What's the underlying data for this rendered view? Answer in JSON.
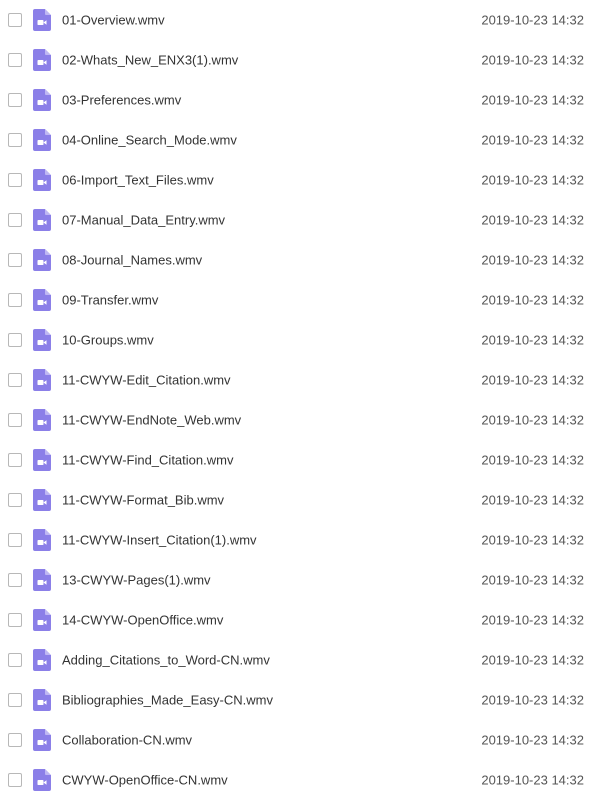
{
  "icon_color": "#8b7fe8",
  "icon_type": "video-file-icon",
  "files": [
    {
      "name": "01-Overview.wmv",
      "date": "2019-10-23 14:32"
    },
    {
      "name": "02-Whats_New_ENX3(1).wmv",
      "date": "2019-10-23 14:32"
    },
    {
      "name": "03-Preferences.wmv",
      "date": "2019-10-23 14:32"
    },
    {
      "name": "04-Online_Search_Mode.wmv",
      "date": "2019-10-23 14:32"
    },
    {
      "name": "06-Import_Text_Files.wmv",
      "date": "2019-10-23 14:32"
    },
    {
      "name": "07-Manual_Data_Entry.wmv",
      "date": "2019-10-23 14:32"
    },
    {
      "name": "08-Journal_Names.wmv",
      "date": "2019-10-23 14:32"
    },
    {
      "name": "09-Transfer.wmv",
      "date": "2019-10-23 14:32"
    },
    {
      "name": "10-Groups.wmv",
      "date": "2019-10-23 14:32"
    },
    {
      "name": "11-CWYW-Edit_Citation.wmv",
      "date": "2019-10-23 14:32"
    },
    {
      "name": "11-CWYW-EndNote_Web.wmv",
      "date": "2019-10-23 14:32"
    },
    {
      "name": "11-CWYW-Find_Citation.wmv",
      "date": "2019-10-23 14:32"
    },
    {
      "name": "11-CWYW-Format_Bib.wmv",
      "date": "2019-10-23 14:32"
    },
    {
      "name": "11-CWYW-Insert_Citation(1).wmv",
      "date": "2019-10-23 14:32"
    },
    {
      "name": "13-CWYW-Pages(1).wmv",
      "date": "2019-10-23 14:32"
    },
    {
      "name": "14-CWYW-OpenOffice.wmv",
      "date": "2019-10-23 14:32"
    },
    {
      "name": "Adding_Citations_to_Word-CN.wmv",
      "date": "2019-10-23 14:32"
    },
    {
      "name": "Bibliographies_Made_Easy-CN.wmv",
      "date": "2019-10-23 14:32"
    },
    {
      "name": "Collaboration-CN.wmv",
      "date": "2019-10-23 14:32"
    },
    {
      "name": "CWYW-OpenOffice-CN.wmv",
      "date": "2019-10-23 14:32"
    }
  ]
}
